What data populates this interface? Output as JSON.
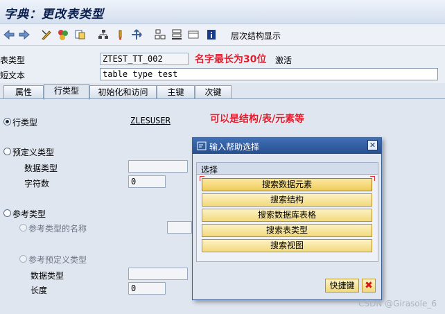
{
  "window": {
    "title": "字典：更改表类型"
  },
  "toolbar": {
    "hierarchy_label": "层次结构显示"
  },
  "header": {
    "table_type_label": "表类型",
    "table_type_value": "ZTEST_TT_002",
    "status": "激活",
    "short_text_label": "短文本",
    "short_text_value": "table type test",
    "annotation_name": "名字最长为30位"
  },
  "tabs": [
    "属性",
    "行类型",
    "初始化和访问",
    "主键",
    "次键"
  ],
  "content": {
    "row_type_label": "行类型",
    "row_type_value": "ZLESUSER",
    "annotation_row": "可以是结构/表/元素等",
    "predefined_label": "预定义类型",
    "data_type_label": "数据类型",
    "char_count_label": "字符数",
    "char_count_value": "0",
    "ref_type_label": "参考类型",
    "ref_name_label": "参考类型的名称",
    "ref_predefined_label": "参考预定义类型",
    "ref_data_type_label": "数据类型",
    "length_label": "长度",
    "length_value": "0"
  },
  "dialog": {
    "title": "输入帮助选择",
    "group_label": "选择",
    "buttons": [
      "搜索数据元素",
      "搜索结构",
      "搜索数据库表格",
      "搜索表类型",
      "搜索视图"
    ],
    "shortcut_label": "快捷键"
  },
  "watermark": "CSDN @Girasole_6",
  "colors": {
    "annotation": "#e8192c",
    "dialog_title": "#2f5c9f",
    "button_fill": "#f5e39a"
  }
}
